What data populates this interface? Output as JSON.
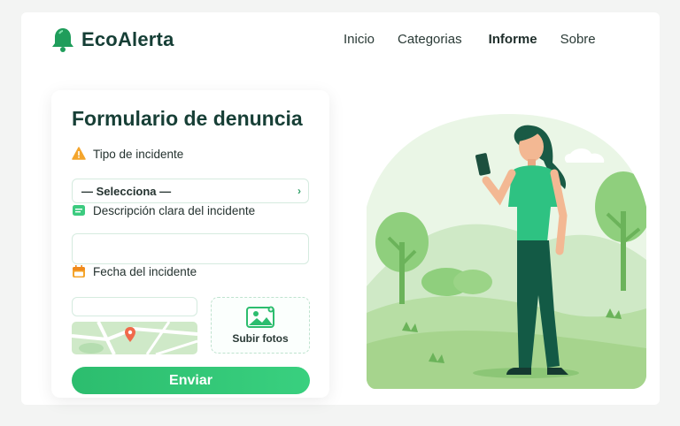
{
  "brand": {
    "name": "EcoAlerta",
    "icon": "bell-icon",
    "color": "#1f9d5b"
  },
  "nav": {
    "items": [
      {
        "label": "Inicio"
      },
      {
        "label": "Categorias"
      },
      {
        "label": "Informe",
        "active": true
      },
      {
        "label": "Sobre"
      }
    ]
  },
  "form": {
    "title": "Formulario de denuncia",
    "incident_type": {
      "label": "Tipo de incidente",
      "icon": "warning-icon",
      "selected": "— Selecciona —"
    },
    "description": {
      "label": "Descripción clara del incidente",
      "icon": "note-icon",
      "value": ""
    },
    "date": {
      "label": "Fecha del incidente",
      "icon": "calendar-icon",
      "value": ""
    },
    "upload": {
      "label": "Subir fotos",
      "icon": "image-icon"
    },
    "submit_label": "Enviar"
  },
  "colors": {
    "accent": "#2cbd6e",
    "title": "#173f36",
    "field_border": "#d5ebdf"
  }
}
